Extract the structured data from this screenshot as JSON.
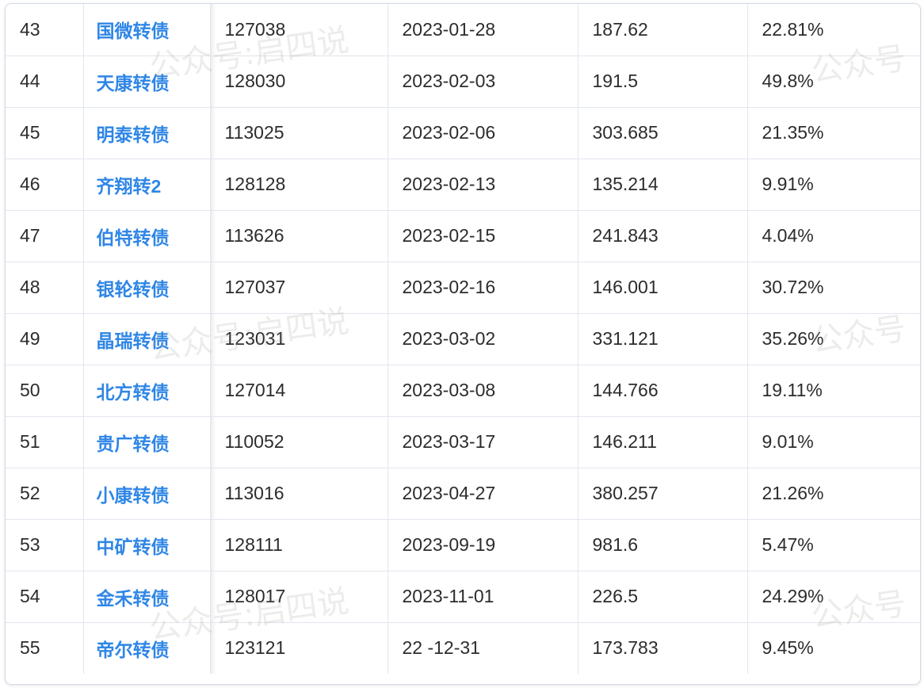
{
  "table": {
    "rows": [
      {
        "index": "43",
        "name": "国微转债",
        "code": "127038",
        "date": "2023-01-28",
        "value": "187.62",
        "percent": "22.81%"
      },
      {
        "index": "44",
        "name": "天康转债",
        "code": "128030",
        "date": "2023-02-03",
        "value": "191.5",
        "percent": "49.8%"
      },
      {
        "index": "45",
        "name": "明泰转债",
        "code": "113025",
        "date": "2023-02-06",
        "value": "303.685",
        "percent": "21.35%"
      },
      {
        "index": "46",
        "name": "齐翔转2",
        "code": "128128",
        "date": "2023-02-13",
        "value": "135.214",
        "percent": "9.91%"
      },
      {
        "index": "47",
        "name": "伯特转债",
        "code": "113626",
        "date": "2023-02-15",
        "value": "241.843",
        "percent": "4.04%"
      },
      {
        "index": "48",
        "name": "银轮转债",
        "code": "127037",
        "date": "2023-02-16",
        "value": "146.001",
        "percent": "30.72%"
      },
      {
        "index": "49",
        "name": "晶瑞转债",
        "code": "123031",
        "date": "2023-03-02",
        "value": "331.121",
        "percent": "35.26%"
      },
      {
        "index": "50",
        "name": "北方转债",
        "code": "127014",
        "date": "2023-03-08",
        "value": "144.766",
        "percent": "19.11%"
      },
      {
        "index": "51",
        "name": "贵广转债",
        "code": "110052",
        "date": "2023-03-17",
        "value": "146.211",
        "percent": "9.01%"
      },
      {
        "index": "52",
        "name": "小康转债",
        "code": "113016",
        "date": "2023-04-27",
        "value": "380.257",
        "percent": "21.26%"
      },
      {
        "index": "53",
        "name": "中矿转债",
        "code": "128111",
        "date": "2023-09-19",
        "value": "981.6",
        "percent": "5.47%"
      },
      {
        "index": "54",
        "name": "金禾转债",
        "code": "128017",
        "date": "2023-11-01",
        "value": "226.5",
        "percent": "24.29%"
      },
      {
        "index": "55",
        "name": "帝尔转债",
        "code": "123121",
        "date": "22 -12-31",
        "value": "173.783",
        "percent": "9.45%"
      }
    ]
  },
  "watermark": {
    "full": "公众号:启四说",
    "short": "公众号"
  }
}
